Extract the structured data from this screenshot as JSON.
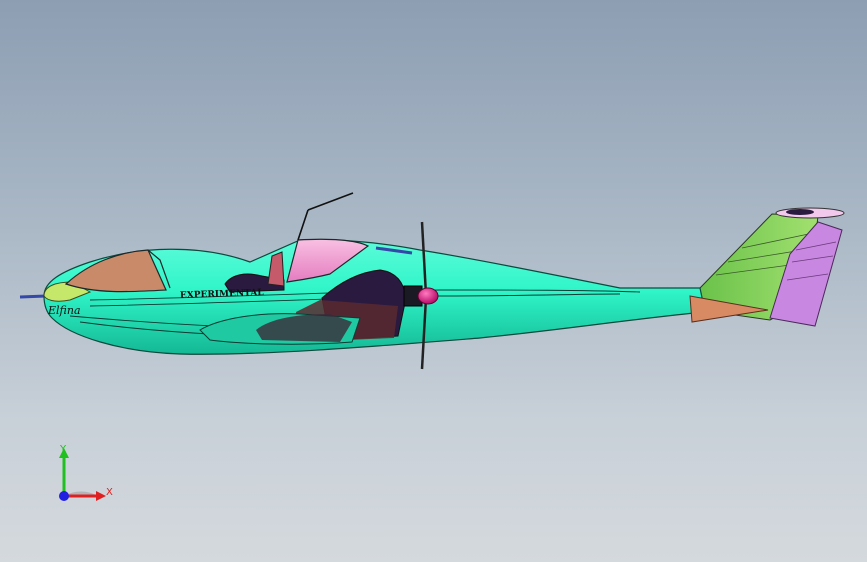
{
  "viewport": {
    "background_top": "#8d9eb3",
    "background_bottom": "#d4d9dd"
  },
  "model": {
    "fuselage_marking": "EXPERIMENTAL",
    "fuselage_logo": "Elfina",
    "colors": {
      "fuselage": "#2ff5c8",
      "fuselage_shadow": "#14b894",
      "canopy_front": "#c98a6a",
      "canopy_rear": "#f7a0d0",
      "nose_cap": "#c6e86a",
      "fin": "#8cd35a",
      "rudder": "#c887e0",
      "tail_cone": "#d88a62",
      "spinner": "#e0107a",
      "dark_cutout": "#2a1a40"
    }
  },
  "triad": {
    "x_label": "X",
    "y_label": "Y",
    "x_color": "#e02020",
    "y_color": "#20c020",
    "z_color": "#2020e0"
  }
}
